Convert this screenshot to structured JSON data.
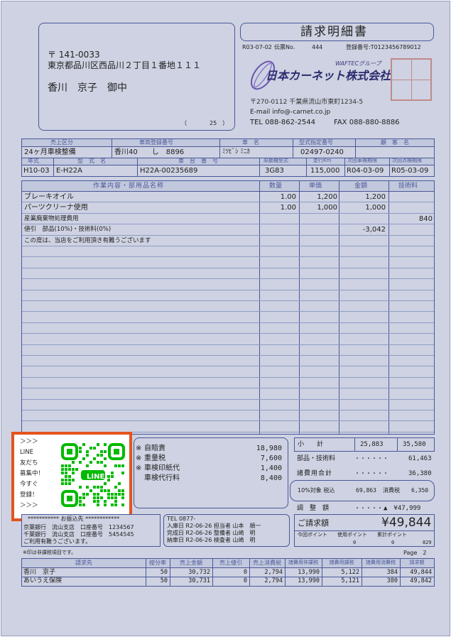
{
  "doc": {
    "title": "請求明細書",
    "doc_code": "R03-07-02",
    "slip_no_label": "伝票No.",
    "slip_no": "444",
    "reg_no": "登録番号:T0123456789012"
  },
  "recipient": {
    "postal": "〒 141-0033",
    "address": "東京都品川区西品川２丁目１番地１１１",
    "name": "香川　京子　御中",
    "page_ref": "（　　　　25　）"
  },
  "company": {
    "group": "WAFTECグループ",
    "name": "日本カーネット株式会社",
    "address": "〒270-0112 千葉県流山市東町1234-5",
    "email": "E-mail info@-carnet.co.jp",
    "tel": "TEL 088-862-2544",
    "fax": "FAX 088-880-8886",
    "seal_text": "日本カーネット株式会社"
  },
  "vehicle": {
    "headers1": [
      "売上区分",
      "車両登録番号",
      "車　名",
      "型式指定番号",
      "顧　客　名"
    ],
    "row1": [
      "24ヶ月車検整備",
      "香川40　　し　8896",
      "ﾐﾂﾋﾞｼ ﾐﾆｶ",
      "02497-0240",
      ""
    ],
    "headers2": [
      "年式",
      "型　式　名",
      "車　台　番　号",
      "原動機型式",
      "走行Km",
      "次回車検期限",
      "次回点検期限"
    ],
    "row2": [
      "H10-03",
      "E-H22A",
      "H22A-00235689",
      "3G83",
      "115,000",
      "R04-03-09",
      "R05-03-09"
    ]
  },
  "items": {
    "headers": [
      "作業内容・部用品名称",
      "数量",
      "単価",
      "金額",
      "技術料"
    ],
    "rows": [
      {
        "name": "ブレーキオイル",
        "qty": "1.00",
        "price": "1,200",
        "amount": "1,200",
        "tech": ""
      },
      {
        "name": "パーツクリーナ使用",
        "qty": "1.00",
        "price": "1,000",
        "amount": "1,000",
        "tech": ""
      },
      {
        "name": "産業廃棄物処理費用",
        "qty": "",
        "price": "",
        "amount": "",
        "tech": "840"
      },
      {
        "name": "値引　部品(10%)・技術料(0%)",
        "qty": "",
        "price": "",
        "amount": "-3,042",
        "tech": ""
      },
      {
        "name": "この度は、当店をご利用頂き有難うございます",
        "qty": "",
        "price": "",
        "amount": "",
        "tech": ""
      }
    ]
  },
  "qr": {
    "lines": [
      "＞＞＞",
      "LINE",
      "友だち",
      "募集中！",
      "今すぐ",
      "登録！",
      "＞＞＞"
    ],
    "logo": "LINE"
  },
  "fees": [
    {
      "mark": "※",
      "label": "自賠責",
      "value": "18,980"
    },
    {
      "mark": "※",
      "label": "重量税",
      "value": "7,600"
    },
    {
      "mark": "※",
      "label": "車検印紙代",
      "value": "1,400"
    },
    {
      "mark": "",
      "label": "車検代行料",
      "value": "8,400"
    }
  ],
  "totals": {
    "subtotal_label": "小　　計",
    "subtotal_amount": "25,883",
    "subtotal_tech": "35,580",
    "parts_label": "部品・技術料",
    "parts_value": "61,463",
    "fees_label": "諸費用合計",
    "fees_value": "36,380",
    "tax_target_label": "10%対象 税込",
    "tax_target_value": "69,863",
    "tax_label": "消費税",
    "tax_value": "6,350",
    "adjust_label": "調　整　額",
    "adjust_value": "▲　¥47,999",
    "dots": "・・・・・・"
  },
  "grand": {
    "label": "ご請求額",
    "amount": "¥49,844",
    "points_label": "今回ポイント　　使用ポイント　　累計ポイント",
    "points_current": "0",
    "points_used": "0",
    "points_total": "829"
  },
  "bank": {
    "title": "*********** お振込先 ************",
    "rows": [
      "京葉銀行　流山支店　口座番号　1234567",
      "千葉銀行　流山支店　口座番号　5454545",
      "ご利用有難うございます。"
    ]
  },
  "schedule": {
    "tel": "TEL 0877-",
    "rows": [
      "入庫日 R2-06-26  担当者 山本　順一",
      "完成日 R2-06-26  整備者 山崎　明",
      "納車日 R2-06-26  検査者 山崎　明"
    ]
  },
  "footnote": "※印は非課税項目です。",
  "page_no": "Page　2",
  "billing": {
    "headers": [
      "請求先",
      "按分率",
      "売上金額",
      "売上値引",
      "売上消費税",
      "諸費用非課税",
      "諸費用課税",
      "諸費用消費税",
      "請求額"
    ],
    "rows": [
      [
        "香川　京子",
        "50",
        "30,732",
        "0",
        "2,794",
        "13,990",
        "5,122",
        "384",
        "49,844"
      ],
      [
        "あいうえ保険",
        "50",
        "30,731",
        "0",
        "2,794",
        "13,990",
        "5,121",
        "380",
        "49,842"
      ]
    ]
  },
  "colors": {
    "accent": "#4a5898",
    "paper": "#ced2e2",
    "highlight": "#e2541e",
    "qr_green": "#00b900"
  }
}
